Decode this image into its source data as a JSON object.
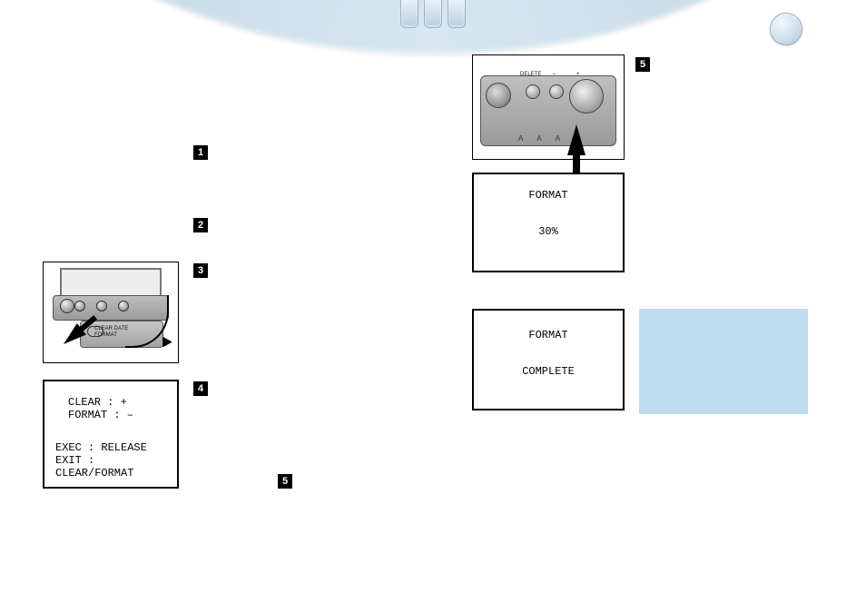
{
  "top": {},
  "steps": {
    "s1": "1",
    "s2": "2",
    "s3": "3",
    "s4": "4",
    "s5a": "5",
    "s5b": "5"
  },
  "lcd_menu": {
    "line1": "CLEAR  : +",
    "line2": "FORMAT :  –",
    "line3": "EXEC : RELEASE",
    "line4": "EXIT : CLEAR/FORMAT"
  },
  "lcd_progress": {
    "title": "FORMAT",
    "value": "30%"
  },
  "lcd_done": {
    "title": "FORMAT",
    "status": "COMPLETE"
  },
  "camtop": {
    "btn_delete": "DELETE",
    "btn_minus": "–",
    "btn_plus": "+",
    "slot_a": "A",
    "slot_b": "A",
    "slot_c": "A"
  },
  "camback": {
    "flap_l1": "CLEAR   DATE",
    "flap_l2": "FORMAT",
    "pwr_icon": "⏻"
  }
}
